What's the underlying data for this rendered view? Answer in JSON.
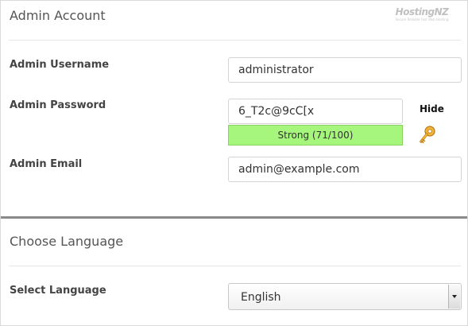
{
  "admin_account": {
    "title": "Admin Account",
    "logo": {
      "brand": "HostingNZ",
      "tagline": "Secure Reliable Fast Web Hosting"
    },
    "username": {
      "label": "Admin Username",
      "value": "administrator"
    },
    "password": {
      "label": "Admin Password",
      "value": "6_T2c@9cC[x",
      "strength_text": "Strong (71/100)",
      "strength_score": 71,
      "strength_color": "#a6f57c",
      "toggle_label": "Hide",
      "generate_icon": "key-icon"
    },
    "email": {
      "label": "Admin Email",
      "value": "admin@example.com"
    }
  },
  "language": {
    "title": "Choose Language",
    "select_label": "Select Language",
    "selected": "English"
  }
}
